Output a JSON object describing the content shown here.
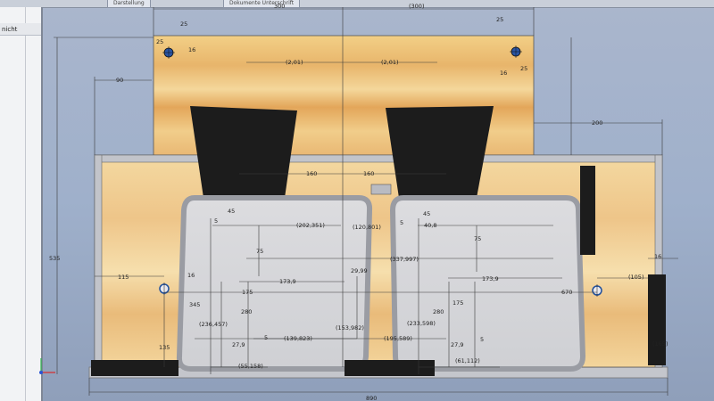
{
  "window": {
    "tab_title": "Dokumente Unterschrift",
    "browser_label": "Darstellung"
  },
  "sidebar": {
    "row_label": "nicht"
  },
  "drawing": {
    "colors": {
      "wood_light": "#f3d9a0",
      "wood_mid": "#e7b977",
      "wood_dark": "#d99a55",
      "panel_gray": "#d3d3d6",
      "frame_gray": "#bfc1c7",
      "black_part": "#1c1c1c",
      "dim_line": "#3a3a3a",
      "hole_blue": "#1f4f9c"
    },
    "dimensions": {
      "top_300": "300",
      "top_300p": "(300)",
      "d25_left": "25",
      "d25_right": "25",
      "d25_left_h": "25",
      "d16_left": "16",
      "d16_right": "16",
      "d25_right_h": "25",
      "d201_a": "(2,01)",
      "d201_b": "(2,01)",
      "d90": "90",
      "d200": "200",
      "d535": "535",
      "d160_a": "160",
      "d160_b": "160",
      "d45_a": "45",
      "d45_b": "45",
      "d5_a": "5",
      "d5_b": "5",
      "d202": "(202,351)",
      "d120": "(120,801)",
      "d40": "40,8",
      "d75_a": "75",
      "d75_b": "75",
      "d337": "(337,997)",
      "d16_c": "16",
      "d115": "115",
      "d16_d": "16",
      "d173_a": "173,9",
      "d29": "29,99",
      "d173_b": "173,9",
      "d105": "(105)",
      "d670": "670",
      "d175_a": "175",
      "d175_b": "175",
      "d345": "345",
      "d280_a": "280",
      "d280_b": "280",
      "d236": "(236,457)",
      "d153": "(153,982)",
      "d233": "(233,598)",
      "d165": "(165)",
      "d135": "135",
      "d27_a": "27,9",
      "d5_c": "5",
      "d139": "(139,823)",
      "d195": "(195,589)",
      "d27_b": "27,9",
      "d5_d": "5",
      "d55": "(55,158)",
      "d61": "(61,112)",
      "d890": "890"
    }
  }
}
